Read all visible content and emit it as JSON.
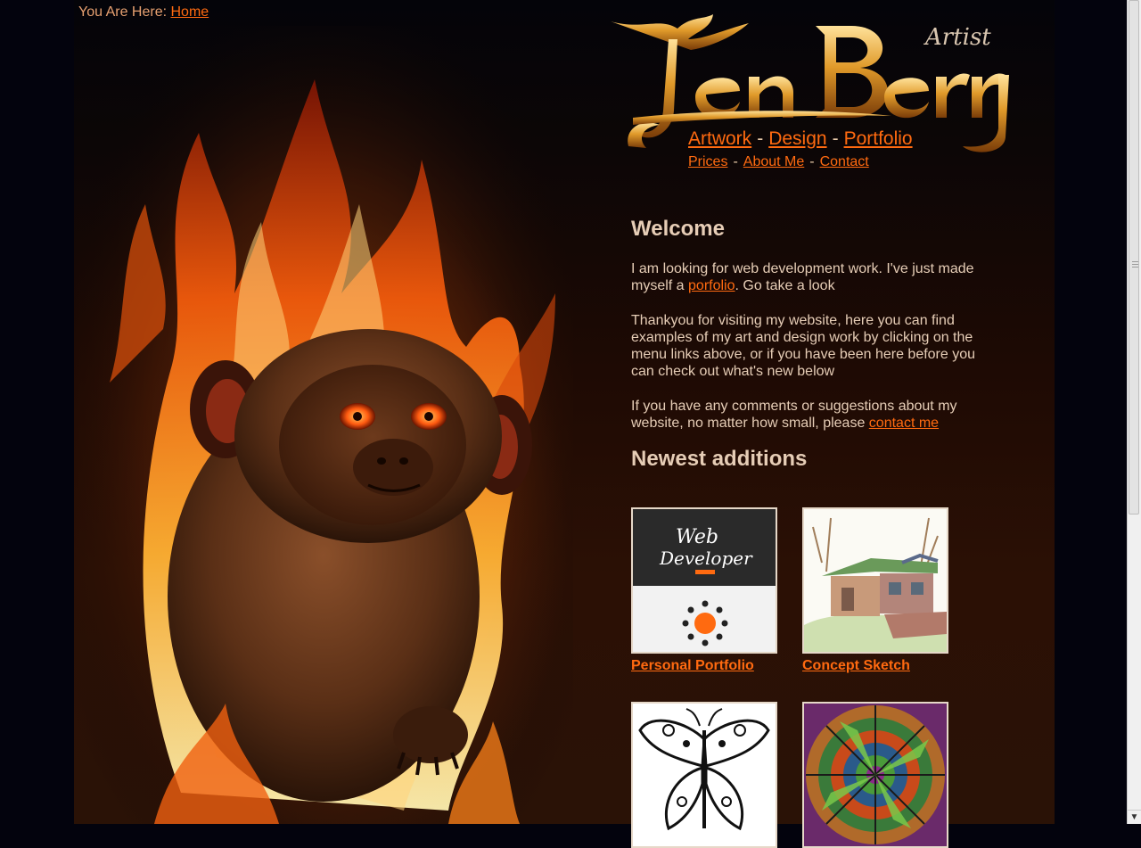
{
  "breadcrumb": {
    "prefix": "You Are Here:",
    "link": "Home"
  },
  "logo": {
    "name": "Jen Berry",
    "tagline": "Artist"
  },
  "nav_main": [
    {
      "label": "Artwork"
    },
    {
      "label": "Design"
    },
    {
      "label": "Portfolio"
    }
  ],
  "nav_sub": [
    {
      "label": "Prices"
    },
    {
      "label": "About Me"
    },
    {
      "label": "Contact"
    }
  ],
  "separator": "-",
  "welcome": {
    "title": "Welcome",
    "p1_a": "I am looking for web development work. I've just made myself a ",
    "p1_link": "porfolio",
    "p1_b": ". Go take a look",
    "p2": "Thankyou for visiting my website, here you can find examples of my art and design work by clicking on the menu links above, or if you have been here before you can check out what's new below",
    "p3_a": "If you have any comments or suggestions about my website, no matter how small, please ",
    "p3_link": "contact me"
  },
  "newest": {
    "title": "Newest additions",
    "items": [
      {
        "caption": "Personal Portfolio",
        "thumb_text_1": "Web",
        "thumb_text_2": "Developer"
      },
      {
        "caption": "Concept Sketch"
      },
      {
        "caption": ""
      },
      {
        "caption": ""
      }
    ]
  },
  "colors": {
    "link": "#ff6a10",
    "text": "#e6cdb6",
    "background": "#03030d"
  }
}
